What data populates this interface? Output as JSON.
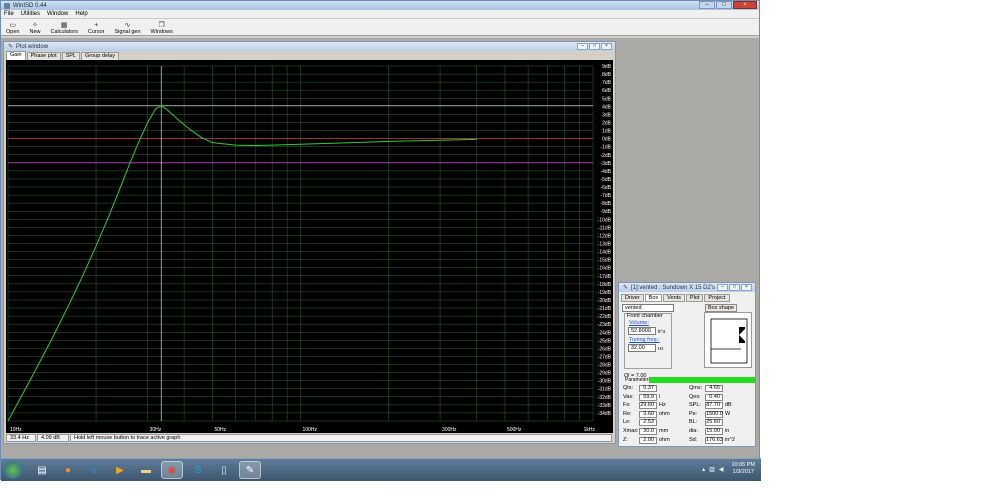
{
  "app": {
    "title": "WinISD 0.44",
    "menu": [
      "File",
      "Utilities",
      "Window",
      "Help"
    ],
    "toolbar": [
      {
        "label": "Open",
        "icon": "folder-icon"
      },
      {
        "label": "New",
        "icon": "new-icon"
      },
      {
        "label": "Calculators",
        "icon": "calculator-icon"
      },
      {
        "label": "Cursor",
        "icon": "crosshair-icon"
      },
      {
        "label": "Signal gen",
        "icon": "signal-icon"
      },
      {
        "label": "Windows",
        "icon": "windows-icon"
      }
    ]
  },
  "plot_window": {
    "title": "Plot window",
    "tabs": [
      "Gain",
      "Phase plot",
      "SPL",
      "Group delay"
    ],
    "active_tab": "Gain",
    "status": {
      "cursor_freq": "33.4 Hz",
      "cursor_db": "4.09 dB",
      "hint": "Hold left mouse button to trace active graph"
    }
  },
  "chart_data": {
    "type": "line",
    "title": "",
    "xlabel": "",
    "ylabel": "",
    "x_scale": "log",
    "xlim": [
      10,
      1000
    ],
    "ylim": [
      -35,
      9
    ],
    "x_tick_labels": [
      "10Hz",
      "30Hz",
      "50Hz",
      "100Hz",
      "300Hz",
      "500Hz",
      "1kHz"
    ],
    "y_tick_labels": [
      "9dB",
      "8dB",
      "7dB",
      "6dB",
      "5dB",
      "4dB",
      "3dB",
      "2dB",
      "1dB",
      "0dB",
      "-1dB",
      "-2dB",
      "-3dB",
      "-4dB",
      "-5dB",
      "-6dB",
      "-7dB",
      "-8dB",
      "-9dB",
      "-10dB",
      "-11dB",
      "-12dB",
      "-13dB",
      "-14dB",
      "-15dB",
      "-16dB",
      "-17dB",
      "-18dB",
      "-19dB",
      "-20dB",
      "-21dB",
      "-22dB",
      "-23dB",
      "-24dB",
      "-25dB",
      "-26dB",
      "-27dB",
      "-28dB",
      "-29dB",
      "-30dB",
      "-31dB",
      "-32dB",
      "-33dB",
      "-34dB"
    ],
    "reference_lines_db": [
      {
        "y": 0,
        "color": "#c83c3c"
      },
      {
        "y": -3,
        "color": "#c83cc8"
      }
    ],
    "cursor": {
      "x": 33.4,
      "y": 4.09
    },
    "grid": true,
    "series": [
      {
        "color": "#33cc33",
        "x": [
          10,
          12,
          14,
          16,
          18,
          20,
          22,
          24,
          26,
          28,
          30,
          32,
          33.4,
          35,
          38,
          42,
          46,
          50,
          60,
          70,
          80,
          100,
          150,
          200,
          300,
          400
        ],
        "y": [
          -35,
          -29.7,
          -25.1,
          -20.9,
          -17.0,
          -13.3,
          -9.8,
          -6.4,
          -3.2,
          -0.4,
          2.0,
          3.7,
          4.09,
          3.6,
          2.4,
          1.1,
          0.1,
          -0.5,
          -0.8,
          -0.85,
          -0.8,
          -0.7,
          -0.5,
          -0.35,
          -0.2,
          -0.1
        ]
      }
    ]
  },
  "vented_window": {
    "title": "[1]:vented : Sundown X 15 D2's",
    "tabs": [
      "Driver",
      "Box",
      "Vents",
      "Plot",
      "Project"
    ],
    "active_tab": "Box",
    "box_name": "vented",
    "box_shape_label": "Box shape",
    "front_chamber_label": "Front chamber",
    "volume_label": "Volume:",
    "volume_value": "52.8000",
    "volume_unit": "ft^3",
    "tuning_label": "Tuning freq.:",
    "tuning_value": "32.00",
    "tuning_unit": "Hz",
    "ql": "Ql = 7.00",
    "params_header": "Parameters",
    "params_left": [
      {
        "name": "Qts:",
        "value": "0.37",
        "unit": ""
      },
      {
        "name": "Vas:",
        "value": "59.9",
        "unit": "l"
      },
      {
        "name": "Fs:",
        "value": "29.60",
        "unit": "Hz"
      },
      {
        "name": "Re:",
        "value": "3.60",
        "unit": "ohm"
      },
      {
        "name": "Le:",
        "value": "2.53",
        "unit": ""
      },
      {
        "name": "Xmax:",
        "value": "30.0",
        "unit": "mm"
      },
      {
        "name": "Z:",
        "value": "2.00",
        "unit": "ohm"
      }
    ],
    "params_right": [
      {
        "name": "Qms:",
        "value": "4.65",
        "unit": ""
      },
      {
        "name": "Qes:",
        "value": "0.40",
        "unit": ""
      },
      {
        "name": "SPL:",
        "value": "87.70",
        "unit": "dB"
      },
      {
        "name": "Pe:",
        "value": "1500.0",
        "unit": "W"
      },
      {
        "name": "BL:",
        "value": "25.60",
        "unit": ""
      },
      {
        "name": "dia:",
        "value": "15.00",
        "unit": "in"
      },
      {
        "name": "Sd:",
        "value": "176.63",
        "unit": "in^2"
      }
    ]
  },
  "taskbar": {
    "apps": [
      "windows-explorer-icon",
      "firefox-icon",
      "ie-icon",
      "media-player-icon",
      "folder-icon",
      "chrome-icon",
      "skype-icon",
      "notepad-icon",
      "winisd-icon"
    ],
    "time": "10:05 PM",
    "date": "1/3/2017"
  }
}
